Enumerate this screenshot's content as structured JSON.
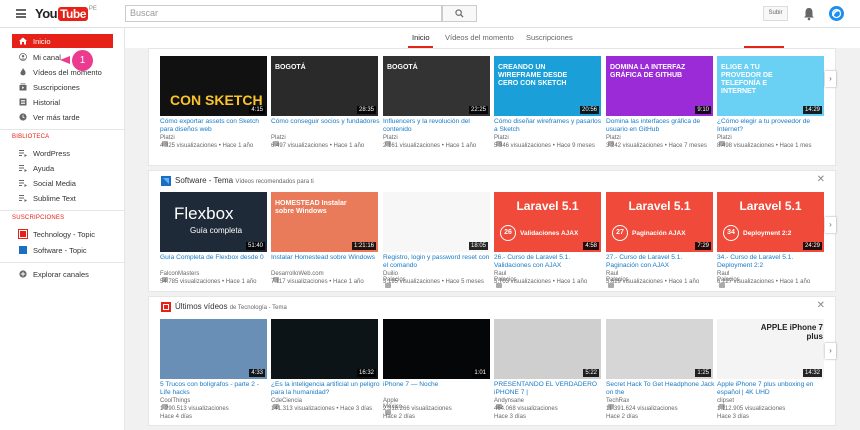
{
  "header": {
    "logo_you": "You",
    "logo_tube": "Tube",
    "logo_country": "PE",
    "search_placeholder": "Buscar",
    "upload_label": "Subir"
  },
  "sidebar": {
    "items": [
      {
        "label": "Inicio",
        "icon": "home-icon"
      },
      {
        "label": "Mi canal",
        "icon": "person-icon"
      },
      {
        "label": "Vídeos del momento",
        "icon": "flame-icon"
      },
      {
        "label": "Suscripciones",
        "icon": "subscriptions-icon"
      },
      {
        "label": "Historial",
        "icon": "history-icon"
      },
      {
        "label": "Ver más tarde",
        "icon": "clock-icon"
      }
    ],
    "library_heading": "BIBLIOTECA",
    "library": [
      "WordPress",
      "Ayuda",
      "Social Media",
      "Sublime Text"
    ],
    "subs_heading": "SUSCRIPCIONES",
    "subs": [
      "Technology - Topic",
      "Software - Topic"
    ],
    "explore": "Explorar canales",
    "badge": "1"
  },
  "tabs": [
    "Inicio",
    "Vídeos del momento",
    "Suscripciones"
  ],
  "sections": [
    {
      "title": "",
      "videos": [
        {
          "title": "Cómo exportar assets con Sketch para diseños web",
          "channel": "Platzi",
          "meta": "4.325 visualizaciones • Hace 1 año",
          "duration": "4:15",
          "thumb_text": "CON SKETCH",
          "bg": "#111111"
        },
        {
          "title": "Cómo conseguir socios y fundadores",
          "channel": "Platzi",
          "meta": "6.497 visualizaciones • Hace 1 año",
          "duration": "28:35",
          "thumb_text": "BOGOTÁ",
          "bg": "#2a2a2a"
        },
        {
          "title": "Influencers y la revolución del contenido",
          "channel": "Platzi",
          "meta": "2.161 visualizaciones • Hace 1 año",
          "duration": "22:25",
          "thumb_text": "BOGOTÁ",
          "bg": "#333333"
        },
        {
          "title": "Cómo diseñar wireframes y pasarlos a Sketch",
          "channel": "Platzi",
          "meta": "5.346 visualizaciones • Hace 9 meses",
          "duration": "20:56",
          "thumb_text": "CREANDO UN WIREFRAME DESDE CERO CON SKETCH",
          "bg": "#1a9fd8"
        },
        {
          "title": "Domina las interfaces gráfica de usuario en GitHub",
          "channel": "Platzi",
          "meta": "3.242 visualizaciones • Hace 7 meses",
          "duration": "9:10",
          "thumb_text": "DOMINA LA INTERFAZ GRÁFICA DE GITHUB",
          "bg": "#9b2bd6"
        },
        {
          "title": "¿Cómo elegir a tu proveedor de Internet?",
          "channel": "Platzi",
          "meta": "8.498 visualizaciones • Hace 1 mes",
          "duration": "14:29",
          "thumb_text": "ELIGE A TU PROVEDOR DE TELEFONÍA E INTERNET",
          "bg": "#6ad1f5"
        }
      ]
    },
    {
      "title": "Software - Tema",
      "subtitle": "Vídeos recomendados para ti",
      "videos": [
        {
          "title": "Guía Completa de Flexbox desde 0",
          "channel": "FalconMasters",
          "meta": "54.785 visualizaciones • Hace 1 año",
          "duration": "51:40",
          "thumb_text": "Flexbox",
          "sub_text": "Guía completa",
          "bg": "#1e2a38"
        },
        {
          "title": "Instalar Homestead sobre Windows",
          "channel": "DesarrolloWeb.com",
          "meta": "7.117 visualizaciones • Hace 1 año",
          "duration": "1:21:16",
          "thumb_text": "HOMESTEAD Instalar sobre Windows",
          "bg": "#e97b5a"
        },
        {
          "title": "Registro, login y password reset con el comando",
          "channel": "Duilio Palacios",
          "meta": "3.195 visualizaciones • Hace 5 meses",
          "duration": "18:05",
          "thumb_text": "",
          "bg": "#f7f7f7"
        },
        {
          "title": "26.- Curso de Laravel 5.1. Validaciones con AJAX",
          "channel": "Raul Palacios",
          "meta": "5.703 visualizaciones • Hace 1 año",
          "duration": "4:58",
          "thumb_text": "Laravel 5.1",
          "num": "26",
          "sub_text": "Validaciones AJAX",
          "bg": "#f04a3a"
        },
        {
          "title": "27.- Curso de Laravel 5.1. Paginación con AJAX",
          "channel": "Raul Palacios",
          "meta": "5.629 visualizaciones • Hace 1 año",
          "duration": "7:29",
          "thumb_text": "Laravel 5.1",
          "num": "27",
          "sub_text": "Paginación AJAX",
          "bg": "#f04a3a"
        },
        {
          "title": "34.- Curso de Laravel 5.1. Deployment 2:2",
          "channel": "Raul Palacios",
          "meta": "6.227 visualizaciones • Hace 1 año",
          "duration": "24:29",
          "thumb_text": "Laravel 5.1",
          "num": "34",
          "sub_text": "Deployment 2:2",
          "bg": "#f04a3a"
        }
      ]
    },
    {
      "title": "Últimos vídeos",
      "subtitle": "de Tecnología - Tema",
      "videos": [
        {
          "title": "5 Trucos con bolígrafos - parte 2 - Life hacks",
          "channel": "CoolThings",
          "meta": "1.290.513 visualizaciones",
          "meta2": "Hace 4 días",
          "duration": "4:33",
          "thumb_text": "",
          "bg": "#6a8fb7"
        },
        {
          "title": "¿Es la inteligencia artificial un peligro para la humanidad?",
          "channel": "CdeCiencia",
          "meta": "141.313 visualizaciones • Hace 3 días",
          "duration": "16:32",
          "thumb_text": "",
          "bg": "#0d1418"
        },
        {
          "title": "iPhone 7 — Noche",
          "channel": "Apple México",
          "meta": "2.318.266 visualizaciones",
          "meta2": "Hace 2 días",
          "duration": "1:01",
          "thumb_text": "",
          "bg": "#050608"
        },
        {
          "title": "PRESENTANDO EL VERDADERO iPHONE 7 |",
          "channel": "Andynsane",
          "meta": "464.068 visualizaciones",
          "meta2": "Hace 3 días",
          "duration": "5:22",
          "thumb_text": "",
          "bg": "#cfcfcf"
        },
        {
          "title": "Secret Hack To Get Headphone Jack on the",
          "channel": "TechRax",
          "meta": "11.391.624 visualizaciones",
          "meta2": "Hace 2 días",
          "duration": "1:25",
          "thumb_text": "",
          "bg": "#d6d6d6"
        },
        {
          "title": "Apple iPhone 7 plus unboxing en español | 4K UHD",
          "channel": "clipset",
          "meta": "1.112.905 visualizaciones",
          "meta2": "Hace 3 días",
          "duration": "14:32",
          "thumb_text": "APPLE iPhone 7 plus",
          "bg": "#f4f4f4"
        }
      ]
    }
  ]
}
